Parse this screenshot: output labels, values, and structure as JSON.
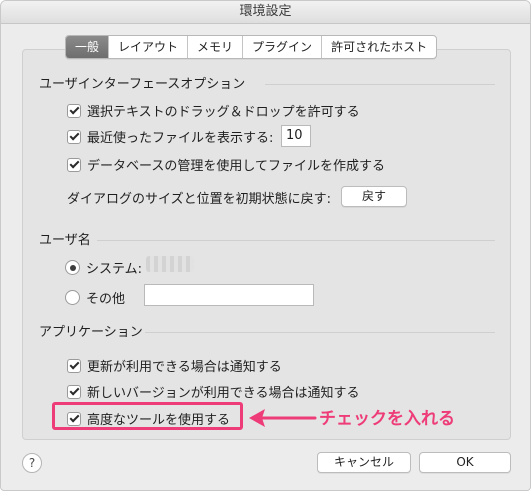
{
  "window": {
    "title": "環境設定"
  },
  "tabs": [
    {
      "label": "一般",
      "active": true
    },
    {
      "label": "レイアウト",
      "active": false
    },
    {
      "label": "メモリ",
      "active": false
    },
    {
      "label": "プラグイン",
      "active": false
    },
    {
      "label": "許可されたホスト",
      "active": false
    }
  ],
  "ui_options": {
    "title": "ユーザインターフェースオプション",
    "drag_drop_label": "選択テキストのドラッグ＆ドロップを許可する",
    "drag_drop_checked": true,
    "recent_files_label": "最近使ったファイルを表示する:",
    "recent_files_checked": true,
    "recent_files_count": "10",
    "db_management_label": "データベースの管理を使用してファイルを作成する",
    "db_management_checked": true,
    "dialog_reset_label": "ダイアログのサイズと位置を初期状態に戻す:",
    "reset_button": "戻す"
  },
  "username": {
    "title": "ユーザ名",
    "system_label": "システム:",
    "system_selected": true,
    "other_label": "その他",
    "other_value": ""
  },
  "application": {
    "title": "アプリケーション",
    "notify_updates_label": "更新が利用できる場合は通知する",
    "notify_updates_checked": true,
    "notify_versions_label": "新しいバージョンが利用できる場合は通知する",
    "notify_versions_checked": true,
    "advanced_tools_label": "高度なツールを使用する",
    "advanced_tools_checked": true
  },
  "annotation": {
    "text": "チェックを入れる",
    "color": "#ee3c78"
  },
  "footer": {
    "help": "?",
    "cancel": "キャンセル",
    "ok": "OK"
  }
}
